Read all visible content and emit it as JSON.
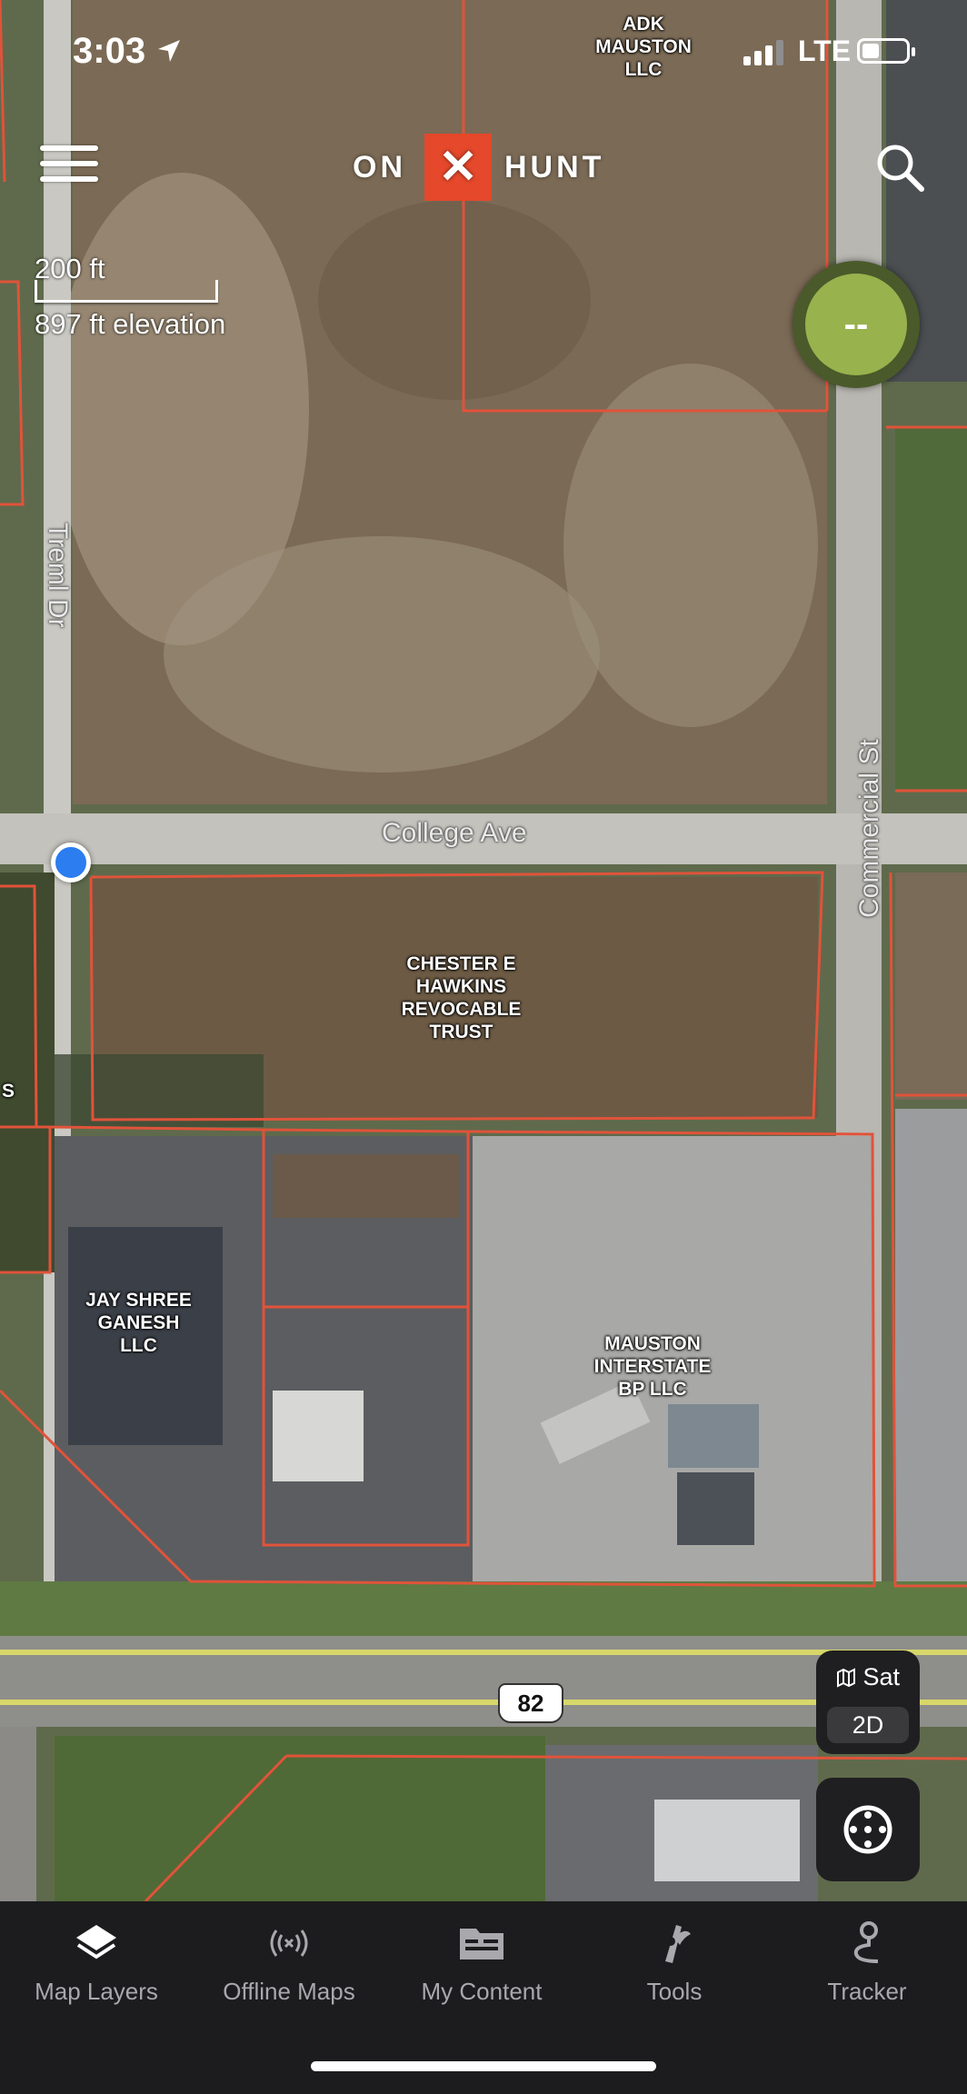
{
  "status_bar": {
    "time": "3:03",
    "network": "LTE"
  },
  "header": {
    "logo_left": "ON",
    "logo_mark": "✕",
    "logo_right": "HUNT"
  },
  "map": {
    "scale_label": "200 ft",
    "elevation": "897 ft elevation",
    "gps_accuracy": "--",
    "roads": {
      "treml": "Treml Dr",
      "college": "College Ave",
      "commercial": "Commercial St",
      "route_shield": "82"
    },
    "parcels": {
      "adk": [
        "ADK",
        "MAUSTON",
        "LLC"
      ],
      "hawkins": [
        "CHESTER E",
        "HAWKINS",
        "REVOCABLE",
        "TRUST"
      ],
      "jay": [
        "JAY SHREE",
        "GANESH",
        "LLC"
      ],
      "bp": [
        "MAUSTON",
        "INTERSTATE",
        "BP LLC"
      ],
      "edge": "S"
    },
    "layer_toggle": {
      "type": "Sat",
      "mode": "2D"
    },
    "parcel_line_color": "#e0533a"
  },
  "tabbar": {
    "items": [
      {
        "label": "Map Layers",
        "icon": "layers-icon"
      },
      {
        "label": "Offline Maps",
        "icon": "offline-signal-icon"
      },
      {
        "label": "My Content",
        "icon": "folder-icon"
      },
      {
        "label": "Tools",
        "icon": "tools-icon"
      },
      {
        "label": "Tracker",
        "icon": "tracker-icon"
      }
    ]
  }
}
